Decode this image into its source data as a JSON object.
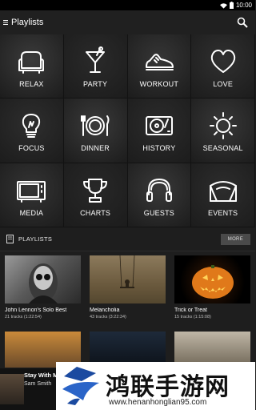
{
  "status_bar": {
    "time": "10:00",
    "icons": [
      "wifi-icon",
      "battery-icon"
    ]
  },
  "app_bar": {
    "title": "Playlists",
    "menu_icon": "hamburger-icon",
    "search_icon": "search-icon"
  },
  "moods": [
    {
      "label": "RELAX",
      "icon": "armchair-icon",
      "bg": "#3b3b3b"
    },
    {
      "label": "PARTY",
      "icon": "cocktail-icon",
      "bg": "#2a2a2a"
    },
    {
      "label": "WORKOUT",
      "icon": "sneaker-icon",
      "bg": "#363636"
    },
    {
      "label": "LOVE",
      "icon": "heart-icon",
      "bg": "#303030"
    },
    {
      "label": "FOCUS",
      "icon": "lightbulb-icon",
      "bg": "#2e2e2e"
    },
    {
      "label": "DINNER",
      "icon": "plate-icon",
      "bg": "#3a3a3a"
    },
    {
      "label": "HISTORY",
      "icon": "turntable-icon",
      "bg": "#2c2c2c"
    },
    {
      "label": "SEASONAL",
      "icon": "sun-icon",
      "bg": "#383838"
    },
    {
      "label": "MEDIA",
      "icon": "tv-icon",
      "bg": "#343434"
    },
    {
      "label": "CHARTS",
      "icon": "trophy-icon",
      "bg": "#282828"
    },
    {
      "label": "GUESTS",
      "icon": "headphones-icon",
      "bg": "#393939"
    },
    {
      "label": "EVENTS",
      "icon": "stage-icon",
      "bg": "#2d2d2d"
    }
  ],
  "playlists_section": {
    "title": "PLAYLISTS",
    "more_label": "MORE",
    "items": [
      {
        "title": "John Lennon's Solo Best",
        "meta": "21 tracks (1:22:54)"
      },
      {
        "title": "Melancholia",
        "meta": "43 tracks (3:22:34)"
      },
      {
        "title": "Trick or Treat",
        "meta": "15 tracks (1:15:08)"
      }
    ]
  },
  "now_playing": {
    "title": "Stay With M",
    "artist": "Sam Smith"
  },
  "watermark": {
    "name": "鸿联手游网",
    "url": "www.henanhonglian95.com"
  }
}
